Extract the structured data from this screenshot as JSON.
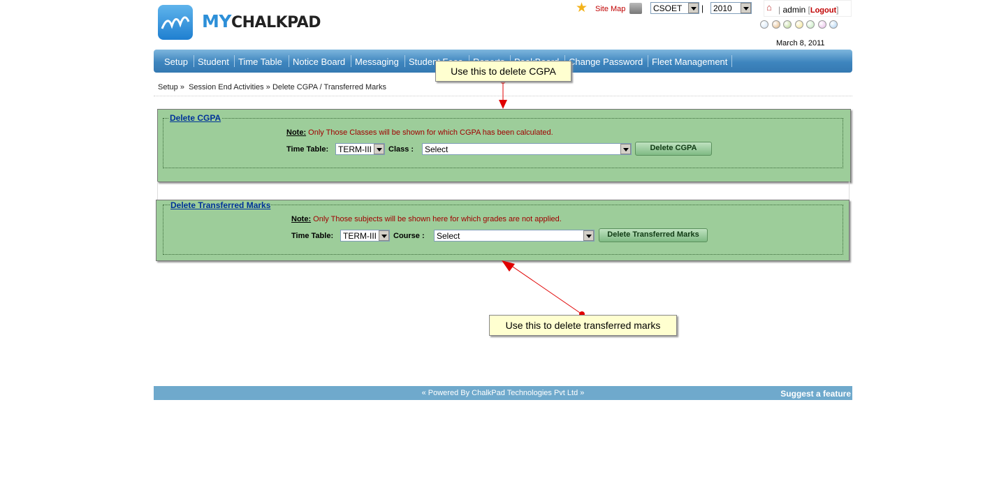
{
  "header": {
    "logo_my": "MY",
    "logo_chalkpad": "CHALKPAD",
    "site_map": "Site Map",
    "org_select": "CSOET",
    "separator": "|",
    "year_select": "2010",
    "user": "admin",
    "logout": "Logout",
    "date": "March 8, 2011",
    "theme_colors": [
      "#cfe3f5",
      "#e0b27a",
      "#b5d48a",
      "#f3e28a",
      "#bfe8b8",
      "#e8b8e8",
      "#a8d0f3"
    ]
  },
  "nav": {
    "items": [
      "Setup",
      "Student",
      "Time Table",
      "Notice Board",
      "Messaging",
      "Student Fees",
      "Reports",
      "PeakBoard",
      "Change Password",
      "Fleet Management"
    ]
  },
  "breadcrumb": {
    "setup": "Setup",
    "arrow1": "»",
    "session_end": "Session End Activities",
    "arrow2": "»",
    "current": "Delete CGPA / Transferred Marks"
  },
  "delete_cgpa": {
    "legend": "Delete CGPA",
    "note_label": "Note:",
    "note_text": " Only Those Classes will be shown for which CGPA has been calculated.",
    "timetable_label": "Time Table:",
    "timetable_value": "TERM-III",
    "class_label": "Class :",
    "class_value": "Select",
    "button": "Delete CGPA"
  },
  "delete_transferred": {
    "legend": "Delete Transferred Marks",
    "note_label": "Note:",
    "note_text": " Only Those subjects will be shown here for which grades are not applied.",
    "timetable_label": "Time Table:",
    "timetable_value": "TERM-III",
    "course_label": "Course :",
    "course_value": "Select",
    "button": "Delete Transferred Marks"
  },
  "callouts": {
    "cgpa": "Use this to delete CGPA",
    "transferred": "Use this to delete transferred marks"
  },
  "footer": {
    "powered": "« Powered By ChalkPad Technologies Pvt Ltd »",
    "suggest": "Suggest a feature"
  },
  "colors": {
    "nav": "#3e85be",
    "panel": "#9dcd9a",
    "footer": "#6fa9cc",
    "callout": "#ffffd0",
    "arrow": "#e00000"
  }
}
